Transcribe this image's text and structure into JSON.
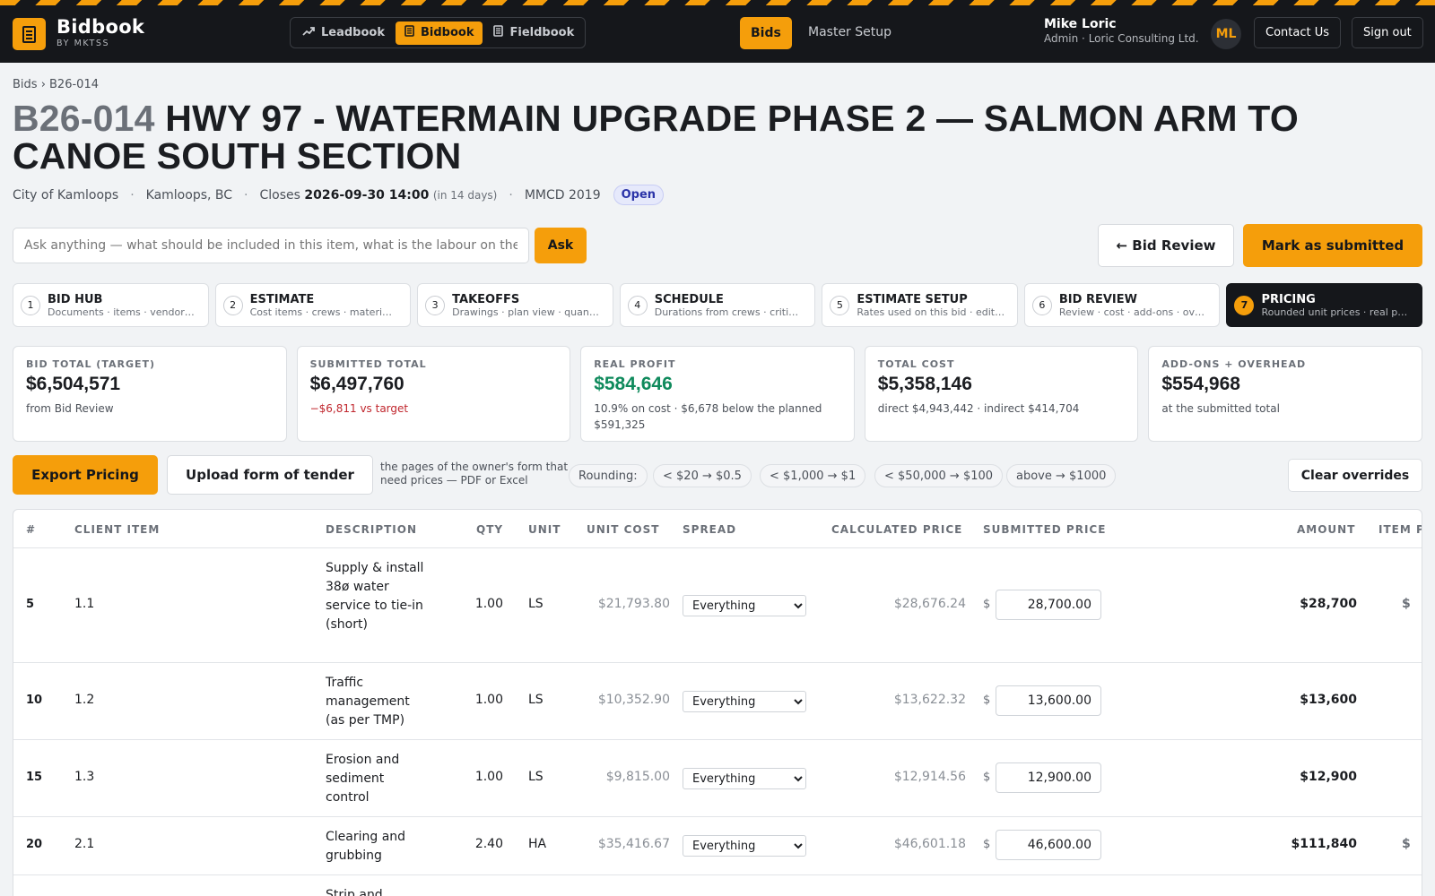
{
  "brand": {
    "name": "Bidbook",
    "sub": "BY MKTSS"
  },
  "apps": [
    {
      "label": "Leadbook",
      "icon": "trend-icon"
    },
    {
      "label": "Bidbook",
      "icon": "document-icon",
      "active": true
    },
    {
      "label": "Fieldbook",
      "icon": "document-icon"
    }
  ],
  "nav": {
    "bids": "Bids",
    "master": "Master Setup"
  },
  "user": {
    "name": "Mike Loric",
    "role": "Admin · Loric Consulting Ltd.",
    "initials": "ML"
  },
  "header_buttons": {
    "contact": "Contact Us",
    "signout": "Sign out"
  },
  "breadcrumb": "Bids › B26-014",
  "project": {
    "code": "B26-014",
    "title": "HWY 97 - WATERMAIN UPGRADE PHASE 2 — SALMON ARM TO CANOE SOUTH SECTION",
    "client": "City of Kamloops",
    "location": "Kamloops, BC",
    "closes_label": "Closes",
    "closes": "2026-09-30 14:00",
    "closes_rel": "(in 14 days)",
    "standard": "MMCD 2019",
    "status": "Open"
  },
  "ask": {
    "placeholder": "Ask anything — what should be included in this item, what is the labour on the w",
    "button": "Ask"
  },
  "actions": {
    "bid_review": "← Bid Review",
    "mark_submitted": "Mark as submitted"
  },
  "steps": [
    {
      "n": "1",
      "label": "BID HUB",
      "sub": "Documents · items · vendor…"
    },
    {
      "n": "2",
      "label": "ESTIMATE",
      "sub": "Cost items · crews · materia…"
    },
    {
      "n": "3",
      "label": "TAKEOFFS",
      "sub": "Drawings · plan view · quan…"
    },
    {
      "n": "4",
      "label": "SCHEDULE",
      "sub": "Durations from crews · criti…"
    },
    {
      "n": "5",
      "label": "ESTIMATE SETUP",
      "sub": "Rates used on this bid · edit…"
    },
    {
      "n": "6",
      "label": "BID REVIEW",
      "sub": "Review · cost · add-ons · ov…"
    },
    {
      "n": "7",
      "label": "PRICING",
      "sub": "Rounded unit prices · real p…",
      "active": true
    }
  ],
  "kpis": [
    {
      "label": "BID TOTAL (TARGET)",
      "value": "$6,504,571",
      "sub": "from Bid Review",
      "tone": ""
    },
    {
      "label": "SUBMITTED TOTAL",
      "value": "$6,497,760",
      "sub": "−$6,811 vs target",
      "tone": "red"
    },
    {
      "label": "REAL PROFIT",
      "value": "$584,646",
      "sub": "10.9% on cost · $6,678 below the planned $591,325",
      "tone": "green"
    },
    {
      "label": "TOTAL COST",
      "value": "$5,358,146",
      "sub": "direct $4,943,442 · indirect $414,704",
      "tone": ""
    },
    {
      "label": "ADD-ONS + OVERHEAD",
      "value": "$554,968",
      "sub": "at the submitted total",
      "tone": ""
    }
  ],
  "toolbar": {
    "export": "Export Pricing",
    "upload": "Upload form of tender",
    "upload_note": "the pages of the owner's form that need prices — PDF or Excel",
    "rounding_label": "Rounding:",
    "rounding_rules": [
      "< $20 → $0.5",
      "< $1,000 → $1",
      "< $50,000 → $100",
      "above → $1000"
    ],
    "clear": "Clear overrides"
  },
  "table": {
    "headers": [
      "#",
      "CLIENT ITEM",
      "DESCRIPTION",
      "QTY",
      "UNIT",
      "UNIT COST",
      "SPREAD",
      "CALCULATED PRICE",
      "SUBMITTED PRICE",
      "AMOUNT",
      "ITEM P"
    ],
    "rows": [
      {
        "num": "5",
        "item": "1.1",
        "desc": "Supply & install 38ø water service to tie-in (short)",
        "qty": "1.00",
        "unit": "LS",
        "unit_cost": "$21,793.80",
        "spread": "Everything",
        "calc": "$28,676.24",
        "currency": "$",
        "submitted": "28,700.00",
        "amount": "$28,700",
        "item_p": "$"
      },
      {
        "num": "10",
        "item": "1.2",
        "desc": "Traffic management (as per TMP)",
        "qty": "1.00",
        "unit": "LS",
        "unit_cost": "$10,352.90",
        "spread": "Everything",
        "calc": "$13,622.32",
        "currency": "$",
        "submitted": "13,600.00",
        "amount": "$13,600",
        "item_p": ""
      },
      {
        "num": "15",
        "item": "1.3",
        "desc": "Erosion and sediment control",
        "qty": "1.00",
        "unit": "LS",
        "unit_cost": "$9,815.00",
        "spread": "Everything",
        "calc": "$12,914.56",
        "currency": "$",
        "submitted": "12,900.00",
        "amount": "$12,900",
        "item_p": ""
      },
      {
        "num": "20",
        "item": "2.1",
        "desc": "Clearing and grubbing",
        "qty": "2.40",
        "unit": "HA",
        "unit_cost": "$35,416.67",
        "spread": "Everything",
        "calc": "$46,601.18",
        "currency": "$",
        "submitted": "46,600.00",
        "amount": "$111,840",
        "item_p": "$"
      },
      {
        "num": "",
        "item": "",
        "desc": "Strip and",
        "qty": "",
        "unit": "",
        "unit_cost": "",
        "spread": "",
        "calc": "",
        "currency": "",
        "submitted": "",
        "amount": "",
        "item_p": ""
      }
    ]
  },
  "colors": {
    "accent": "#f59e0b",
    "dark": "#15171b",
    "profit": "#0f8a5c",
    "negative": "#c0262d"
  }
}
